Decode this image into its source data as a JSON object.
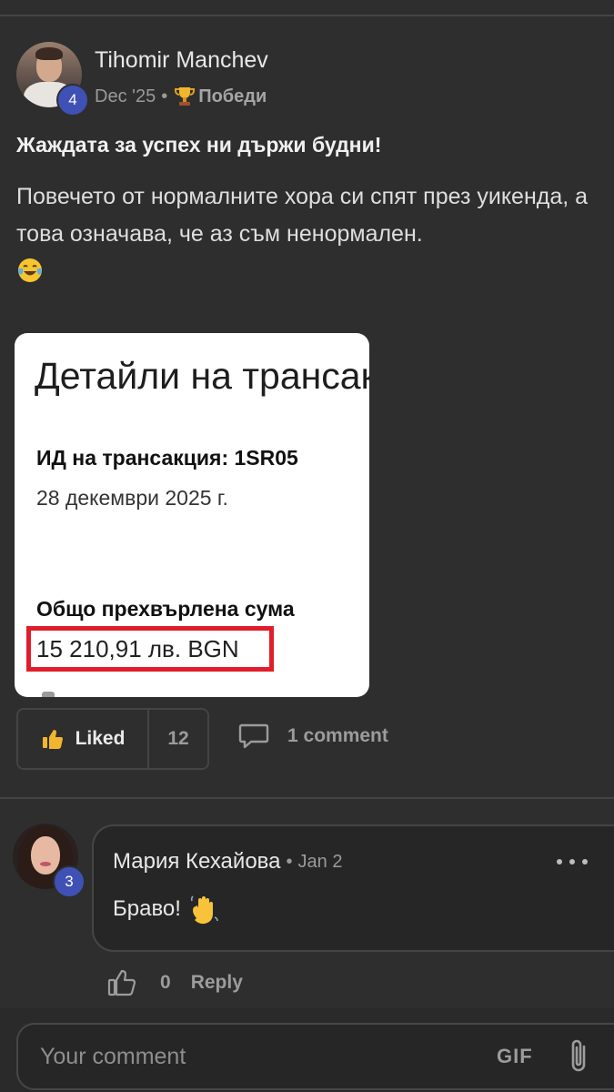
{
  "post": {
    "author": "Tihomir Manchev",
    "author_level": "4",
    "date": "Dec '25",
    "separator": "•",
    "category": "Победи",
    "title": "Жаждата за успех ни държи будни!",
    "body": "Повечето от нормалните хора си спят през уикенда, а това означава, че аз съм ненормален.",
    "body_emoji": "tears-of-joy-emoji",
    "attachment": {
      "title": "Детайли на трансакция",
      "transaction_id": "ИД на трансакция: 1SR05",
      "date": "28 декември 2025 г.",
      "total_label": "Общо прехвърлена сума",
      "amount": "15 210,91 лв. BGN",
      "highlight_color": "#e01e2b"
    }
  },
  "actions": {
    "like_label": "Liked",
    "like_count": "12",
    "comment_count": "1 comment"
  },
  "comment": {
    "author": "Мария Кехайова",
    "author_level": "3",
    "separator": "•",
    "date": "Jan 2",
    "text": "Браво!",
    "emoji": "waving-hand-emoji",
    "like_count": "0",
    "reply_label": "Reply"
  },
  "composer": {
    "placeholder": "Your comment",
    "gif_label": "GIF"
  },
  "colors": {
    "background": "#2e2e2e",
    "level_badge": "#3f51b5",
    "text_muted": "#9c9c9c"
  }
}
